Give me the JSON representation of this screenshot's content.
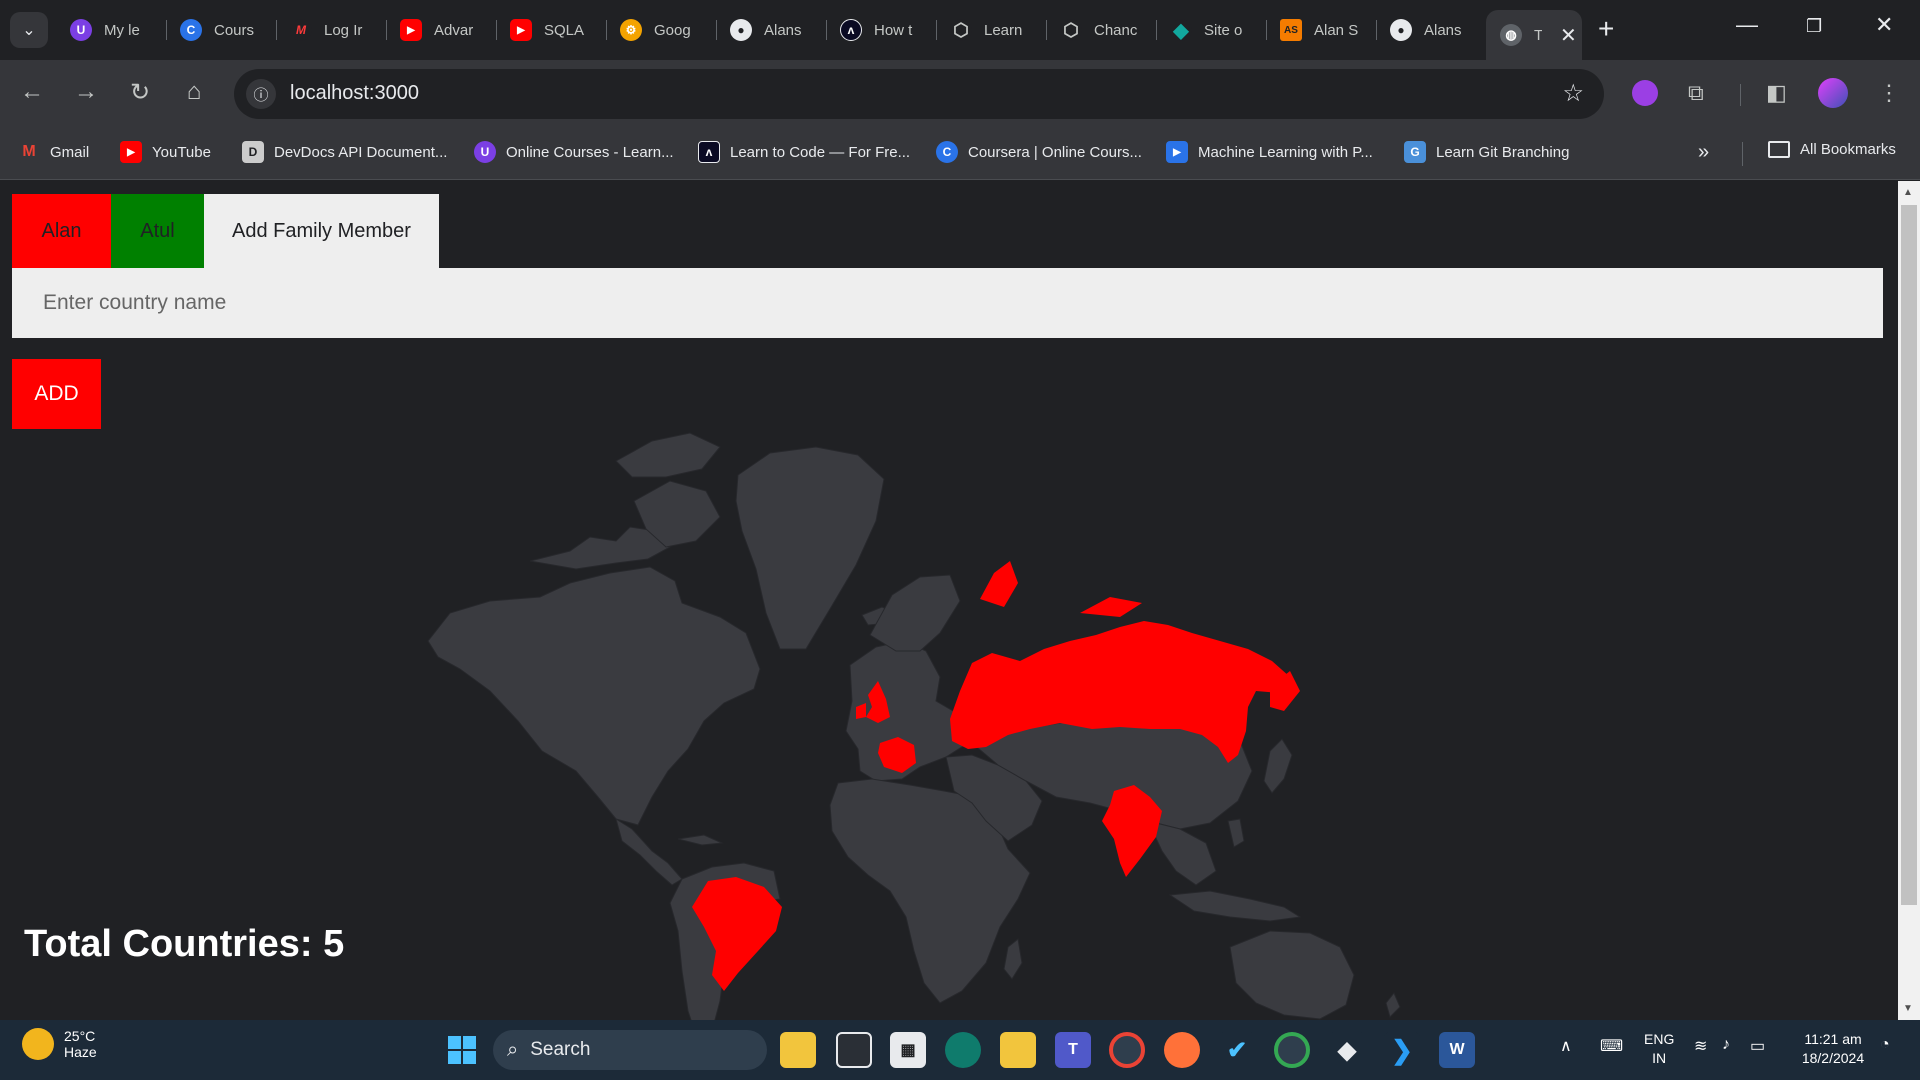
{
  "browser": {
    "tabs": [
      {
        "title": "My le",
        "color": "#7b3fe4",
        "glyph": "U"
      },
      {
        "title": "Cours",
        "color": "#2a73e8",
        "glyph": "C"
      },
      {
        "title": "Log Ir",
        "color": "#202124",
        "glyph": "M"
      },
      {
        "title": "Advar",
        "color": "#ff0000",
        "glyph": "▶"
      },
      {
        "title": "SQLA",
        "color": "#ff0000",
        "glyph": "▶"
      },
      {
        "title": "Goog",
        "color": "#f4a300",
        "glyph": "⚙"
      },
      {
        "title": "Alans",
        "color": "#202124",
        "glyph": "●"
      },
      {
        "title": "How t",
        "color": "#0a0a23",
        "glyph": "ʌ"
      },
      {
        "title": "Learn",
        "color": "#202124",
        "glyph": "⬡"
      },
      {
        "title": "Chanc",
        "color": "#202124",
        "glyph": "⬡"
      },
      {
        "title": "Site o",
        "color": "#12a89e",
        "glyph": "◆"
      },
      {
        "title": "Alan S",
        "color": "#f57c00",
        "glyph": "AS"
      },
      {
        "title": "Alans",
        "color": "#202124",
        "glyph": "●"
      }
    ],
    "active_tab": {
      "title": "T",
      "glyph": "🌐"
    },
    "address": "localhost:3000"
  },
  "bookmarks": [
    {
      "label": "Gmail",
      "color": "#ea4335",
      "glyph": "M"
    },
    {
      "label": "YouTube",
      "color": "#ff0000",
      "glyph": "▶"
    },
    {
      "label": "DevDocs API Document...",
      "color": "#cccccc",
      "glyph": "D"
    },
    {
      "label": "Online Courses - Learn...",
      "color": "#7b3fe4",
      "glyph": "U"
    },
    {
      "label": "Learn to Code — For Fre...",
      "color": "#0a0a23",
      "glyph": "ʌ"
    },
    {
      "label": "Coursera | Online Cours...",
      "color": "#2a73e8",
      "glyph": "C"
    },
    {
      "label": "Machine Learning with P...",
      "color": "#2a73e8",
      "glyph": "▶"
    },
    {
      "label": "Learn Git Branching",
      "color": "#4a90d9",
      "glyph": "G"
    }
  ],
  "bookmarks_all": "All Bookmarks",
  "app": {
    "members": [
      {
        "name": "Alan",
        "color": "#ff0000"
      },
      {
        "name": "Atul",
        "color": "#008000"
      }
    ],
    "add_member_label": "Add Family Member",
    "country_placeholder": "Enter country name",
    "add_label": "ADD",
    "total_label": "Total Countries: 5",
    "visited_color": "#ff0000",
    "land_color": "#3a3b40"
  },
  "taskbar": {
    "temperature": "25°C",
    "weather": "Haze",
    "search": "Search",
    "lang": "ENG",
    "region": "IN",
    "time": "11:21 am",
    "date": "18/2/2024"
  }
}
